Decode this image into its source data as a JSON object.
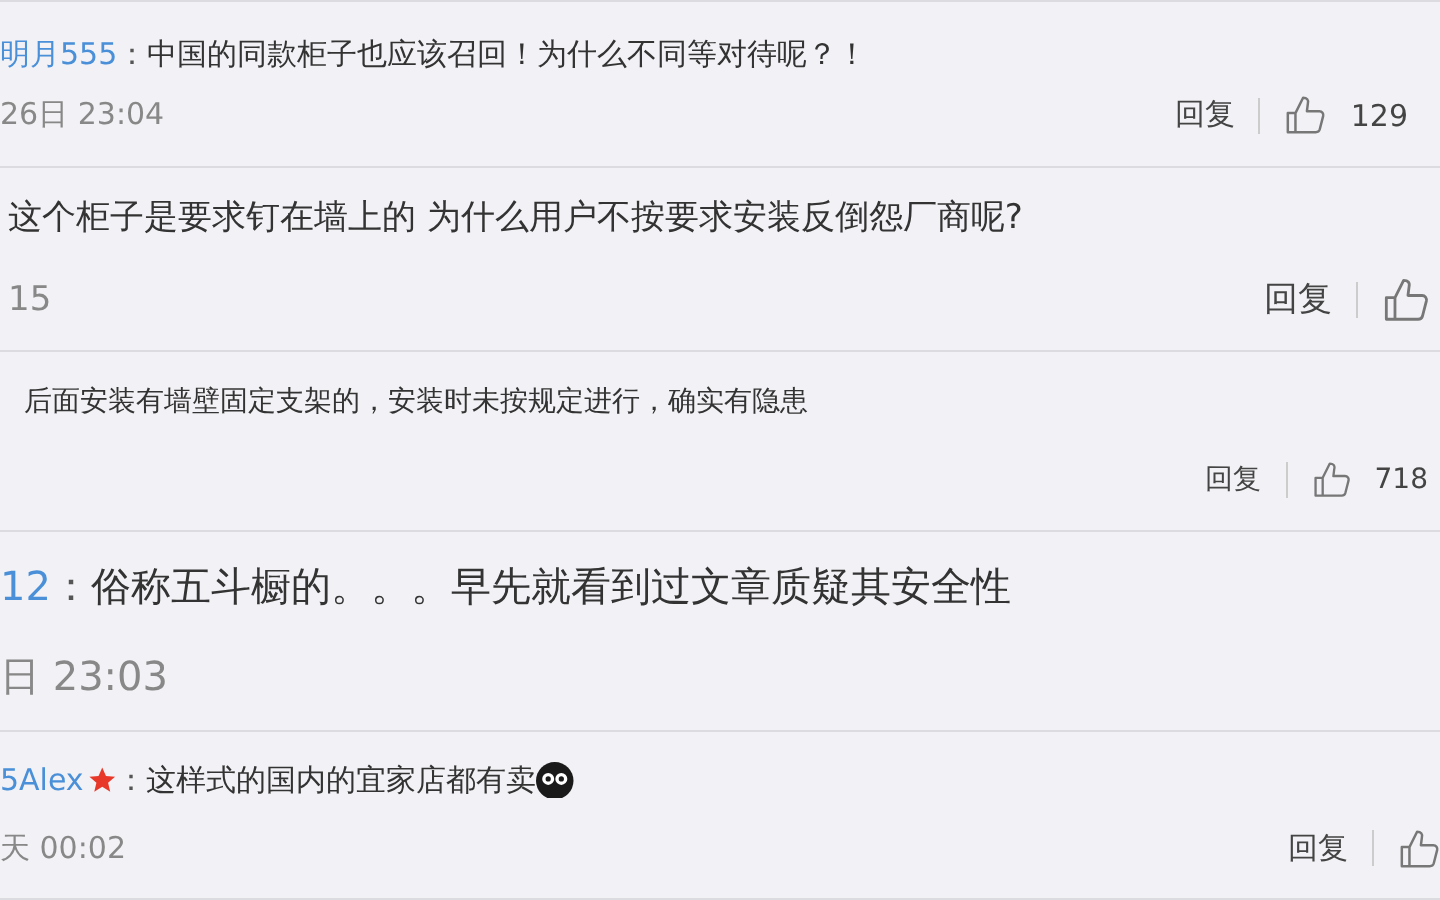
{
  "comments": [
    {
      "user": "明月555",
      "colon": "：",
      "text": "中国的同款柜子也应该召回！为什么不同等对待呢？！",
      "time": "26日 23:04",
      "reply": "回复",
      "like": true,
      "likes": "129"
    },
    {
      "text": "这个柜子是要求钉在墙上的 为什么用户不按要求安装反倒怨厂商呢?",
      "time": "15",
      "reply": "回复",
      "like": true
    },
    {
      "text": "后面安装有墙壁固定支架的，安装时未按规定进行，确实有隐患",
      "reply": "回复",
      "like": true,
      "likes": "718"
    },
    {
      "user": "12",
      "colon": "：",
      "text": "俗称五斗橱的。。。早先就看到过文章质疑其安全性",
      "time": "日 23:03"
    },
    {
      "user": "5Alex",
      "colon": "：",
      "starred": true,
      "text": "这样式的国内的宜家店都有卖",
      "emoji": true,
      "time": "天 00:02",
      "reply": "回复",
      "like": true
    }
  ]
}
